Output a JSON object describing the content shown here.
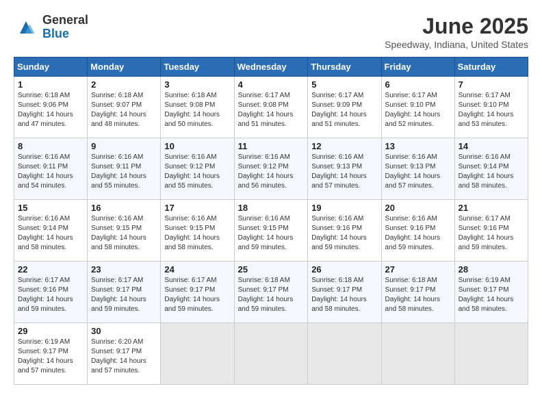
{
  "header": {
    "logo_general": "General",
    "logo_blue": "Blue",
    "month_year": "June 2025",
    "location": "Speedway, Indiana, United States"
  },
  "weekdays": [
    "Sunday",
    "Monday",
    "Tuesday",
    "Wednesday",
    "Thursday",
    "Friday",
    "Saturday"
  ],
  "weeks": [
    [
      {
        "day": "1",
        "info": "Sunrise: 6:18 AM\nSunset: 9:06 PM\nDaylight: 14 hours\nand 47 minutes."
      },
      {
        "day": "2",
        "info": "Sunrise: 6:18 AM\nSunset: 9:07 PM\nDaylight: 14 hours\nand 48 minutes."
      },
      {
        "day": "3",
        "info": "Sunrise: 6:18 AM\nSunset: 9:08 PM\nDaylight: 14 hours\nand 50 minutes."
      },
      {
        "day": "4",
        "info": "Sunrise: 6:17 AM\nSunset: 9:08 PM\nDaylight: 14 hours\nand 51 minutes."
      },
      {
        "day": "5",
        "info": "Sunrise: 6:17 AM\nSunset: 9:09 PM\nDaylight: 14 hours\nand 51 minutes."
      },
      {
        "day": "6",
        "info": "Sunrise: 6:17 AM\nSunset: 9:10 PM\nDaylight: 14 hours\nand 52 minutes."
      },
      {
        "day": "7",
        "info": "Sunrise: 6:17 AM\nSunset: 9:10 PM\nDaylight: 14 hours\nand 53 minutes."
      }
    ],
    [
      {
        "day": "8",
        "info": "Sunrise: 6:16 AM\nSunset: 9:11 PM\nDaylight: 14 hours\nand 54 minutes."
      },
      {
        "day": "9",
        "info": "Sunrise: 6:16 AM\nSunset: 9:11 PM\nDaylight: 14 hours\nand 55 minutes."
      },
      {
        "day": "10",
        "info": "Sunrise: 6:16 AM\nSunset: 9:12 PM\nDaylight: 14 hours\nand 55 minutes."
      },
      {
        "day": "11",
        "info": "Sunrise: 6:16 AM\nSunset: 9:12 PM\nDaylight: 14 hours\nand 56 minutes."
      },
      {
        "day": "12",
        "info": "Sunrise: 6:16 AM\nSunset: 9:13 PM\nDaylight: 14 hours\nand 57 minutes."
      },
      {
        "day": "13",
        "info": "Sunrise: 6:16 AM\nSunset: 9:13 PM\nDaylight: 14 hours\nand 57 minutes."
      },
      {
        "day": "14",
        "info": "Sunrise: 6:16 AM\nSunset: 9:14 PM\nDaylight: 14 hours\nand 58 minutes."
      }
    ],
    [
      {
        "day": "15",
        "info": "Sunrise: 6:16 AM\nSunset: 9:14 PM\nDaylight: 14 hours\nand 58 minutes."
      },
      {
        "day": "16",
        "info": "Sunrise: 6:16 AM\nSunset: 9:15 PM\nDaylight: 14 hours\nand 58 minutes."
      },
      {
        "day": "17",
        "info": "Sunrise: 6:16 AM\nSunset: 9:15 PM\nDaylight: 14 hours\nand 58 minutes."
      },
      {
        "day": "18",
        "info": "Sunrise: 6:16 AM\nSunset: 9:15 PM\nDaylight: 14 hours\nand 59 minutes."
      },
      {
        "day": "19",
        "info": "Sunrise: 6:16 AM\nSunset: 9:16 PM\nDaylight: 14 hours\nand 59 minutes."
      },
      {
        "day": "20",
        "info": "Sunrise: 6:16 AM\nSunset: 9:16 PM\nDaylight: 14 hours\nand 59 minutes."
      },
      {
        "day": "21",
        "info": "Sunrise: 6:17 AM\nSunset: 9:16 PM\nDaylight: 14 hours\nand 59 minutes."
      }
    ],
    [
      {
        "day": "22",
        "info": "Sunrise: 6:17 AM\nSunset: 9:16 PM\nDaylight: 14 hours\nand 59 minutes."
      },
      {
        "day": "23",
        "info": "Sunrise: 6:17 AM\nSunset: 9:17 PM\nDaylight: 14 hours\nand 59 minutes."
      },
      {
        "day": "24",
        "info": "Sunrise: 6:17 AM\nSunset: 9:17 PM\nDaylight: 14 hours\nand 59 minutes."
      },
      {
        "day": "25",
        "info": "Sunrise: 6:18 AM\nSunset: 9:17 PM\nDaylight: 14 hours\nand 59 minutes."
      },
      {
        "day": "26",
        "info": "Sunrise: 6:18 AM\nSunset: 9:17 PM\nDaylight: 14 hours\nand 58 minutes."
      },
      {
        "day": "27",
        "info": "Sunrise: 6:18 AM\nSunset: 9:17 PM\nDaylight: 14 hours\nand 58 minutes."
      },
      {
        "day": "28",
        "info": "Sunrise: 6:19 AM\nSunset: 9:17 PM\nDaylight: 14 hours\nand 58 minutes."
      }
    ],
    [
      {
        "day": "29",
        "info": "Sunrise: 6:19 AM\nSunset: 9:17 PM\nDaylight: 14 hours\nand 57 minutes."
      },
      {
        "day": "30",
        "info": "Sunrise: 6:20 AM\nSunset: 9:17 PM\nDaylight: 14 hours\nand 57 minutes."
      },
      {
        "day": "",
        "info": ""
      },
      {
        "day": "",
        "info": ""
      },
      {
        "day": "",
        "info": ""
      },
      {
        "day": "",
        "info": ""
      },
      {
        "day": "",
        "info": ""
      }
    ]
  ]
}
